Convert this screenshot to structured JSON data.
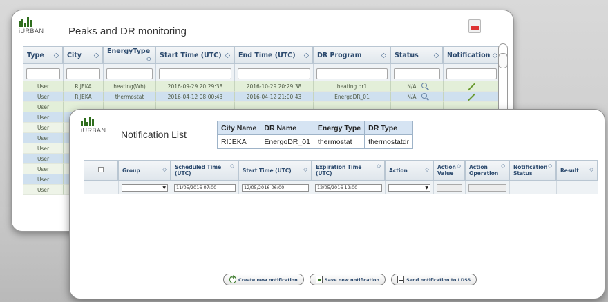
{
  "back": {
    "logo_text": "iURBAN",
    "title": "Peaks and DR monitoring",
    "columns": [
      "Type",
      "City",
      "EnergyType",
      "Start Time (UTC)",
      "End Time (UTC)",
      "DR Program",
      "Status",
      "Notification"
    ],
    "rows": [
      [
        "User",
        "RIJEKA",
        "heating(Wh)",
        "2016-09-29 20:29:38",
        "2016-10-29 20:29:38",
        "heating dr1",
        "N/A"
      ],
      [
        "User",
        "RIJEKA",
        "thermostat",
        "2016-04-12 08:00:43",
        "2016-04-12 21:00:43",
        "EnergoDR_01",
        "N/A"
      ],
      [
        "User",
        "",
        "",
        "",
        "",
        "",
        ""
      ],
      [
        "User",
        "",
        "",
        "",
        "",
        "",
        ""
      ],
      [
        "User",
        "",
        "",
        "",
        "",
        "",
        ""
      ],
      [
        "User",
        "",
        "",
        "",
        "",
        "",
        ""
      ],
      [
        "User",
        "",
        "",
        "",
        "",
        "",
        ""
      ],
      [
        "User",
        "",
        "",
        "",
        "",
        "",
        ""
      ],
      [
        "User",
        "",
        "",
        "",
        "",
        "",
        ""
      ],
      [
        "User",
        "",
        "",
        "",
        "",
        "",
        ""
      ],
      [
        "User",
        "",
        "",
        "",
        "",
        "",
        ""
      ]
    ],
    "sort_glyph": "◇",
    "icons": {
      "export": "pdf-icon",
      "details": "magnifier-icon",
      "edit": "pencil-icon"
    }
  },
  "front": {
    "logo_text": "iURBAN",
    "title": "Notification List",
    "info": {
      "headers": [
        "City Name",
        "DR Name",
        "Energy Type",
        "DR Type"
      ],
      "values": [
        "RIJEKA",
        "EnergoDR_01",
        "thermostat",
        "thermostatdr"
      ]
    },
    "columns": [
      "Group",
      "Scheduled Time (UTC)",
      "Start Time (UTC)",
      "Expiration Time (UTC)",
      "Action",
      "Action Value",
      "Action Operation",
      "Notification Status",
      "Result"
    ],
    "edit_row": {
      "group": "",
      "scheduled": "11/05/2016 07:00",
      "start": "12/05/2016 06:00",
      "expiration": "12/05/2016 19:00",
      "action": ""
    },
    "buttons": {
      "create": "Create new notification",
      "save": "Save new notification",
      "send": "Send notification to LDSS"
    }
  },
  "colors": {
    "header_text": "#2c4a6e",
    "row_green": "#e3efd9",
    "row_selected": "#cfe0ef",
    "logo_green": "#2f6e1d"
  }
}
